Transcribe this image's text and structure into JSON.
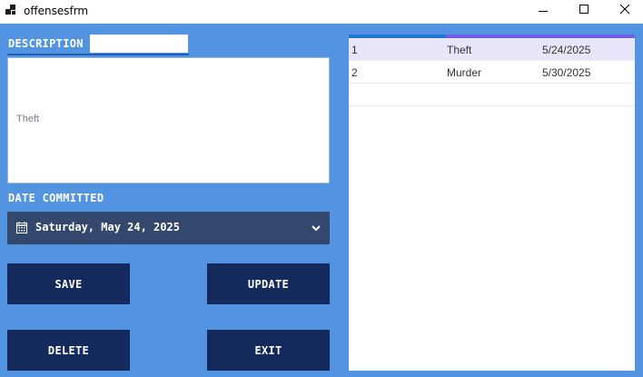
{
  "window": {
    "title": "offensesfrm",
    "minimize_icon": "minimize-icon",
    "maximize_icon": "maximize-icon",
    "close_icon": "close-icon"
  },
  "form": {
    "description_label": "DESCRIPTION",
    "description_input_value": "",
    "description_text": "Theft",
    "date_label": "DATE COMMITTED",
    "date_value": "Saturday, May 24, 2025",
    "calendar_icon": "calendar-icon",
    "dropdown_icon": "chevron-down-icon"
  },
  "buttons": {
    "save": "SAVE",
    "update": "UPDATE",
    "delete": "DELETE",
    "exit": "EXIT"
  },
  "grid": {
    "rows": [
      {
        "id": "1",
        "offense": "Theft",
        "date": "5/24/2025",
        "selected": true
      },
      {
        "id": "2",
        "offense": "Murder",
        "date": "5/30/2025",
        "selected": false
      }
    ]
  },
  "colors": {
    "background": "#5294e2",
    "button": "#142a5c",
    "date_picker": "#34476d",
    "selected_row": "#e9e6fb"
  }
}
